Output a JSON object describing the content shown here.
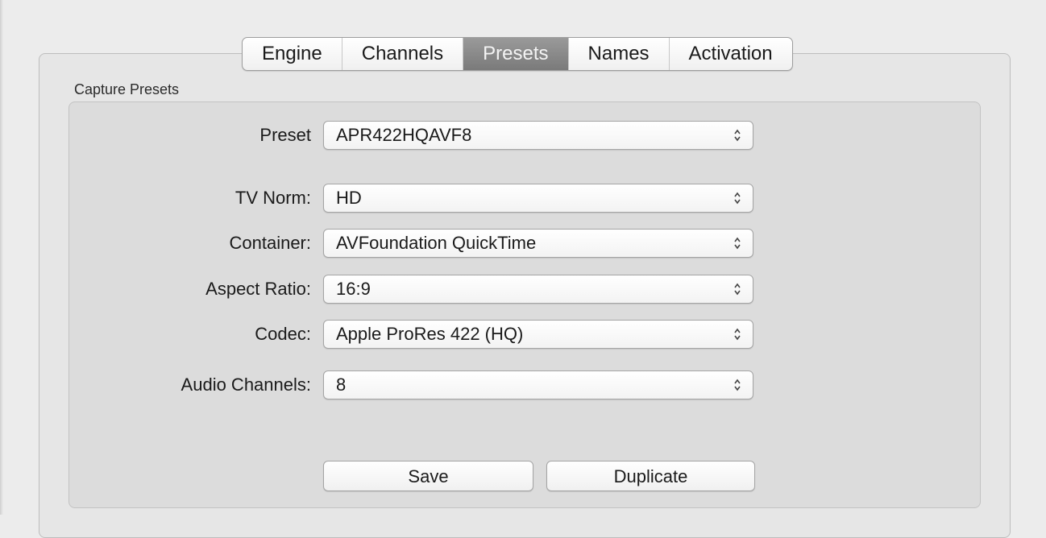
{
  "tabs": {
    "items": [
      {
        "label": "Engine"
      },
      {
        "label": "Channels"
      },
      {
        "label": "Presets"
      },
      {
        "label": "Names"
      },
      {
        "label": "Activation"
      }
    ],
    "active": "Presets"
  },
  "group": {
    "title": "Capture Presets"
  },
  "fields": {
    "preset": {
      "label": "Preset",
      "value": "APR422HQAVF8"
    },
    "tv_norm": {
      "label": "TV Norm:",
      "value": "HD"
    },
    "container": {
      "label": "Container:",
      "value": "AVFoundation QuickTime"
    },
    "aspect": {
      "label": "Aspect Ratio:",
      "value": "16:9"
    },
    "codec": {
      "label": "Codec:",
      "value": "Apple ProRes 422 (HQ)"
    },
    "audio": {
      "label": "Audio Channels:",
      "value": "8"
    }
  },
  "buttons": {
    "save": "Save",
    "duplicate": "Duplicate"
  },
  "icons": {
    "popup_arrows": "up-down-chevron-icon"
  }
}
